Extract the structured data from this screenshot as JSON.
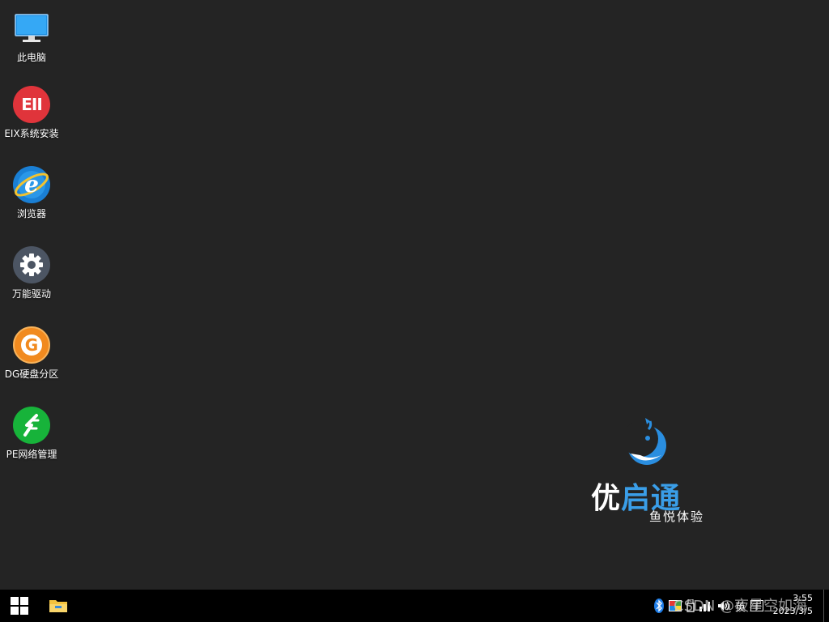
{
  "desktop": {
    "icons": [
      {
        "label": "此电脑",
        "icon": "monitor-icon"
      },
      {
        "label": "EIX系统安装",
        "icon": "eix-icon"
      },
      {
        "label": "浏览器",
        "icon": "ie-browser-icon"
      },
      {
        "label": "万能驱动",
        "icon": "gear-icon"
      },
      {
        "label": "DG硬盘分区",
        "icon": "dg-partition-icon"
      },
      {
        "label": "PE网络管理",
        "icon": "network-manager-icon"
      }
    ],
    "brand": {
      "name_part1": "优",
      "name_part2": "启通",
      "subtitle": "鱼悦体验"
    },
    "eix_glyph": "EII",
    "dg_glyph": "G",
    "ie_glyph": "e"
  },
  "taskbar": {
    "clock_time": "3:55",
    "clock_date": "2023/3/5",
    "tray_text": "CSDN @夜星空如海",
    "ime_label": "英",
    "colors": {
      "background": "#000000",
      "accent": "#3a9ee8"
    }
  }
}
